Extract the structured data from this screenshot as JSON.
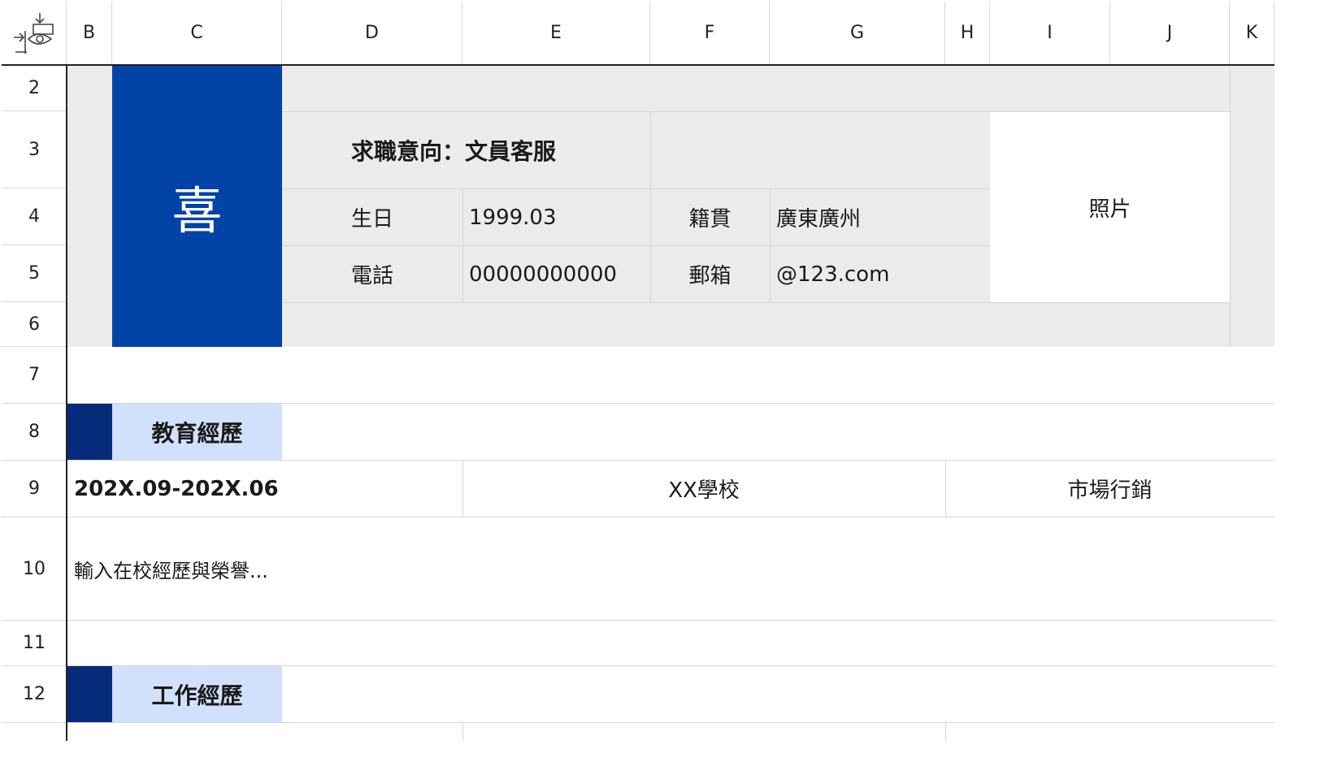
{
  "columns": [
    "B",
    "C",
    "D",
    "E",
    "F",
    "G",
    "H",
    "I",
    "J",
    "K"
  ],
  "rows": [
    "2",
    "3",
    "4",
    "5",
    "6",
    "7",
    "8",
    "9",
    "10",
    "11",
    "12"
  ],
  "colors": {
    "accent_blue": "#0243a8",
    "dark_navy": "#062b7a",
    "light_blue": "#d2e1fb",
    "panel_grey": "#ebebeb",
    "photo_white": "#ffffff"
  },
  "corner": {
    "icon": "freeze-panes-eye-icon"
  },
  "resume": {
    "name_char": "喜",
    "job_intent": "求職意向：文員客服",
    "birthday_label": "生日",
    "birthday_value": "1999.03",
    "origin_label": "籍貫",
    "origin_value": "廣東廣州",
    "phone_label": "電話",
    "phone_value": "00000000000",
    "email_label": "郵箱",
    "email_value": "@123.com",
    "photo_label": "照片"
  },
  "education": {
    "title": "教育經歷",
    "period": "202X.09-202X.06",
    "school": "XX學校",
    "major": "市場行銷",
    "detail_placeholder": "輸入在校經歷與榮譽..."
  },
  "work": {
    "title": "工作經歷"
  }
}
